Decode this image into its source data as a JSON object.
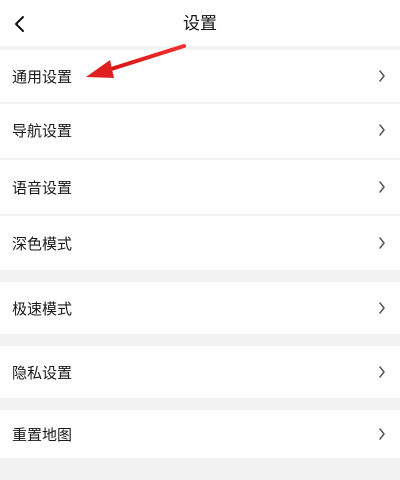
{
  "header": {
    "title": "设置"
  },
  "menu": {
    "items": [
      {
        "label": "通用设置"
      },
      {
        "label": "导航设置"
      },
      {
        "label": "语音设置"
      },
      {
        "label": "深色模式"
      },
      {
        "label": "极速模式"
      },
      {
        "label": "隐私设置"
      },
      {
        "label": "重置地图"
      }
    ]
  },
  "colors": {
    "annotation_arrow": "#e02020",
    "divider": "#f2f2f2",
    "background": "#ffffff"
  },
  "icons": {
    "back": "chevron-left-icon",
    "row": "chevron-right-icon",
    "annotation": "red-arrow-icon"
  }
}
